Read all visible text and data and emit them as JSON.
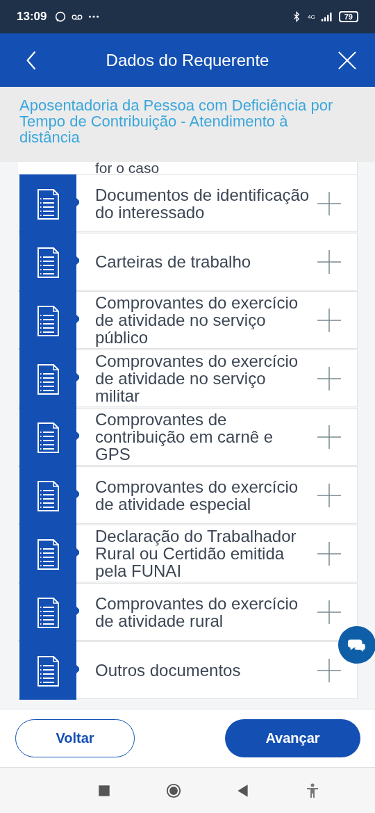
{
  "status_bar": {
    "time": "13:09",
    "network": "4G",
    "battery": "79"
  },
  "header": {
    "title": "Dados do Requerente"
  },
  "subtitle": "Aposentadoria da Pessoa com Deficiência por Tempo de Contribuição - Atendimento à distância",
  "cut_text": "for o caso",
  "documents": [
    {
      "label": "Documentos de identificação do interessado"
    },
    {
      "label": "Carteiras de trabalho"
    },
    {
      "label": "Comprovantes do exercício de atividade no serviço público"
    },
    {
      "label": "Comprovantes do exercício de atividade no serviço militar"
    },
    {
      "label": "Comprovantes de contribuição em carnê e GPS"
    },
    {
      "label": "Comprovantes do exercício de atividade especial"
    },
    {
      "label": "Declaração do Trabalhador Rural ou Certidão emitida pela FUNAI"
    },
    {
      "label": "Comprovantes do exercício de atividade rural"
    },
    {
      "label": "Outros documentos"
    }
  ],
  "buttons": [
    {
      "label": "Voltar",
      "kind": "secondary"
    },
    {
      "label": "Avançar",
      "kind": "primary"
    }
  ]
}
